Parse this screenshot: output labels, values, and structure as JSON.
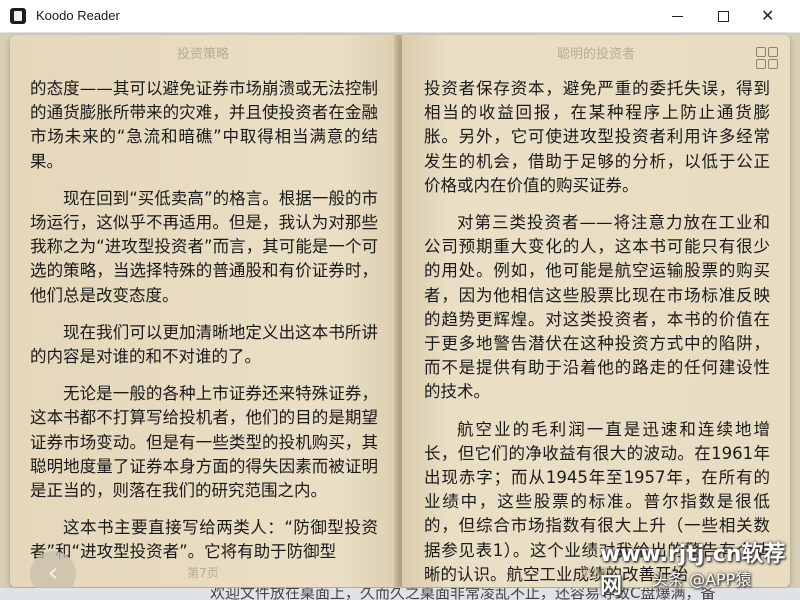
{
  "window": {
    "title": "Koodo Reader",
    "min_symbol": "",
    "max_symbol": "",
    "close_symbol": "✕"
  },
  "left_page": {
    "header": "投资策略",
    "footer": "第7页",
    "paragraphs": [
      "的态度——其可以避免证券市场崩溃或无法控制的通货膨胀所带来的灾难，并且使投资者在金融市场未来的“急流和暗礁”中取得相当满意的结果。",
      "现在回到“买低卖高”的格言。根据一般的市场运行，这似乎不再适用。但是，我认为对那些我称之为“进攻型投资者”而言，其可能是一个可选的策略，当选择特殊的普通股和有价证券时，他们总是改变态度。",
      "现在我们可以更加清晰地定义出这本书所讲的内容是对谁的和不对谁的了。",
      "无论是一般的各种上市证券还来特殊证券，这本书都不打算写给投机者，他们的目的是期望证券市场变动。但是有一些类型的投机购买，其聪明地度量了证券本身方面的得失因素而被证明是正当的，则落在我们的研究范围之内。",
      "这本书主要直接写给两类人：“防御型投资者”和“进攻型投资者”。它将有助于防御型"
    ]
  },
  "right_page": {
    "header": "聪明的投资者",
    "footer": "第8页",
    "paragraphs": [
      "投资者保存资本，避免严重的委托失误，得到相当的收益回报，在某种程序上防止通货膨胀。另外，它可使进攻型投资者利用许多经常发生的机会，借助于足够的分析，以低于公正价格或内在价值的购买证券。",
      "对第三类投资者——将注意力放在工业和公司预期重大变化的人，这本书可能只有很少的用处。例如，他可能是航空运输股票的购买者，因为他相信这些股票比现在市场标准反映的趋势更辉煌。对这类投资者，本书的价值在于更多地警告潜伏在这种投资方式中的陷阱，而不是提供有助于沿着他的路走的任何建设性的技术。",
      "航空业的毛利润一直是迅速和连续地增长，但它们的净收益有很大的波动。在1961年出现赤字；而从1945年至1957年，在所有的业绩中，这些股票的标准。普尔指数是很低的，但综合市场指数有很大上升（一些相关数据参见表1）。这个业绩对我给出的警告有个清晰的认识。航空工业成绩的改善开始"
    ]
  },
  "controls": {
    "back_symbol": "‹"
  },
  "watermark": {
    "line1": "www.rjtj.cn软荐网",
    "line2": "头条 @APP猿"
  },
  "bottom_partial_text": "欢迎文件放在桌面上，久而久之桌面非常凌乱不止，还容易导致C盘爆满，备"
}
